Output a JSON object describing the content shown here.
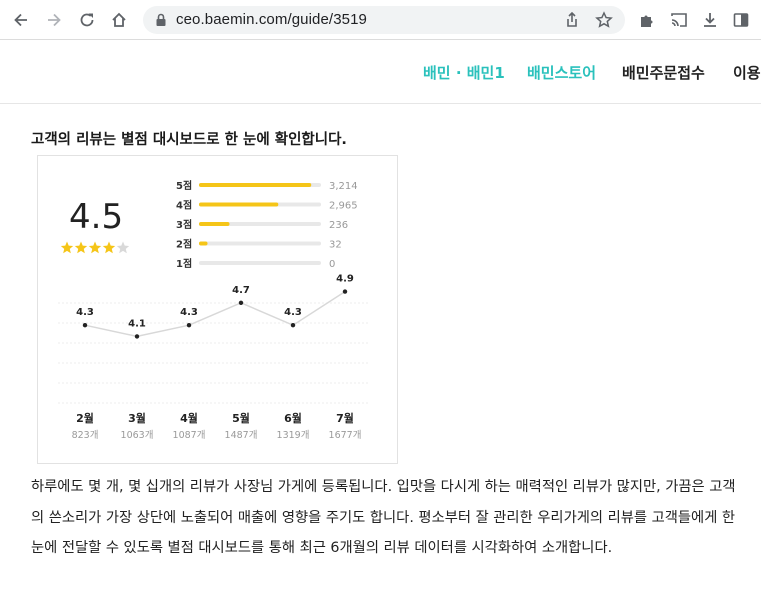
{
  "browser": {
    "url": "ceo.baemin.com/guide/3519",
    "icons": [
      "back-arrow-icon",
      "forward-arrow-icon",
      "reload-icon",
      "home-icon",
      "lock-icon",
      "share-icon",
      "star-icon",
      "puzzle-icon",
      "cast-icon",
      "download-icon",
      "sidebar-icon"
    ]
  },
  "nav": {
    "items": [
      {
        "label": "배민 · 배민1",
        "color": "#2ac1bc"
      },
      {
        "label": "배민스토어",
        "color": "#2ac1bc"
      },
      {
        "label": "배민주문접수",
        "color": "#222222"
      },
      {
        "label": "이용",
        "color": "#222222"
      }
    ]
  },
  "article": {
    "heading": "고객의 리뷰는 별점 대시보드로 한 눈에 확인합니다.",
    "paragraph": "하루에도 몇 개, 몇 십개의 리뷰가 사장님 가게에 등록됩니다. 입맛을 다시게 하는 매력적인 리뷰가 많지만, 가끔은 고객의 쓴소리가 가장 상단에 노출되어 매출에 영향을 주기도 합니다. 평소부터 잘 관리한 우리가게의 리뷰를 고객들에게 한 눈에 전달할 수 있도록 별점 대시보드를 통해 최근 6개월의 리뷰 데이터를 시각화하여 소개합니다."
  },
  "chart_data": [
    {
      "type": "bar",
      "orientation": "horizontal",
      "overall_rating": "4.5",
      "stars_filled": 4,
      "stars_total": 5,
      "categories": [
        "5점",
        "4점",
        "3점",
        "2점",
        "1점"
      ],
      "values": [
        3214,
        2965,
        236,
        32,
        0
      ],
      "value_labels": [
        "3,214",
        "2,965",
        "236",
        "32",
        "0"
      ],
      "bar_fill_fraction": [
        0.92,
        0.65,
        0.25,
        0.07,
        0.0
      ],
      "bar_color": "#f5c518",
      "track_color": "#e8e8e8"
    },
    {
      "type": "line",
      "categories": [
        "2월",
        "3월",
        "4월",
        "5월",
        "6월",
        "7월"
      ],
      "values": [
        4.3,
        4.1,
        4.3,
        4.7,
        4.3,
        4.9
      ],
      "value_labels": [
        "4.3",
        "4.1",
        "4.3",
        "4.7",
        "4.3",
        "4.9"
      ],
      "counts": [
        "823개",
        "1063개",
        "1087개",
        "1487개",
        "1319개",
        "1677개"
      ],
      "ylim": [
        3.0,
        5.5
      ],
      "grid": true,
      "line_color": "#d8d8d8",
      "point_color": "#222222"
    }
  ]
}
